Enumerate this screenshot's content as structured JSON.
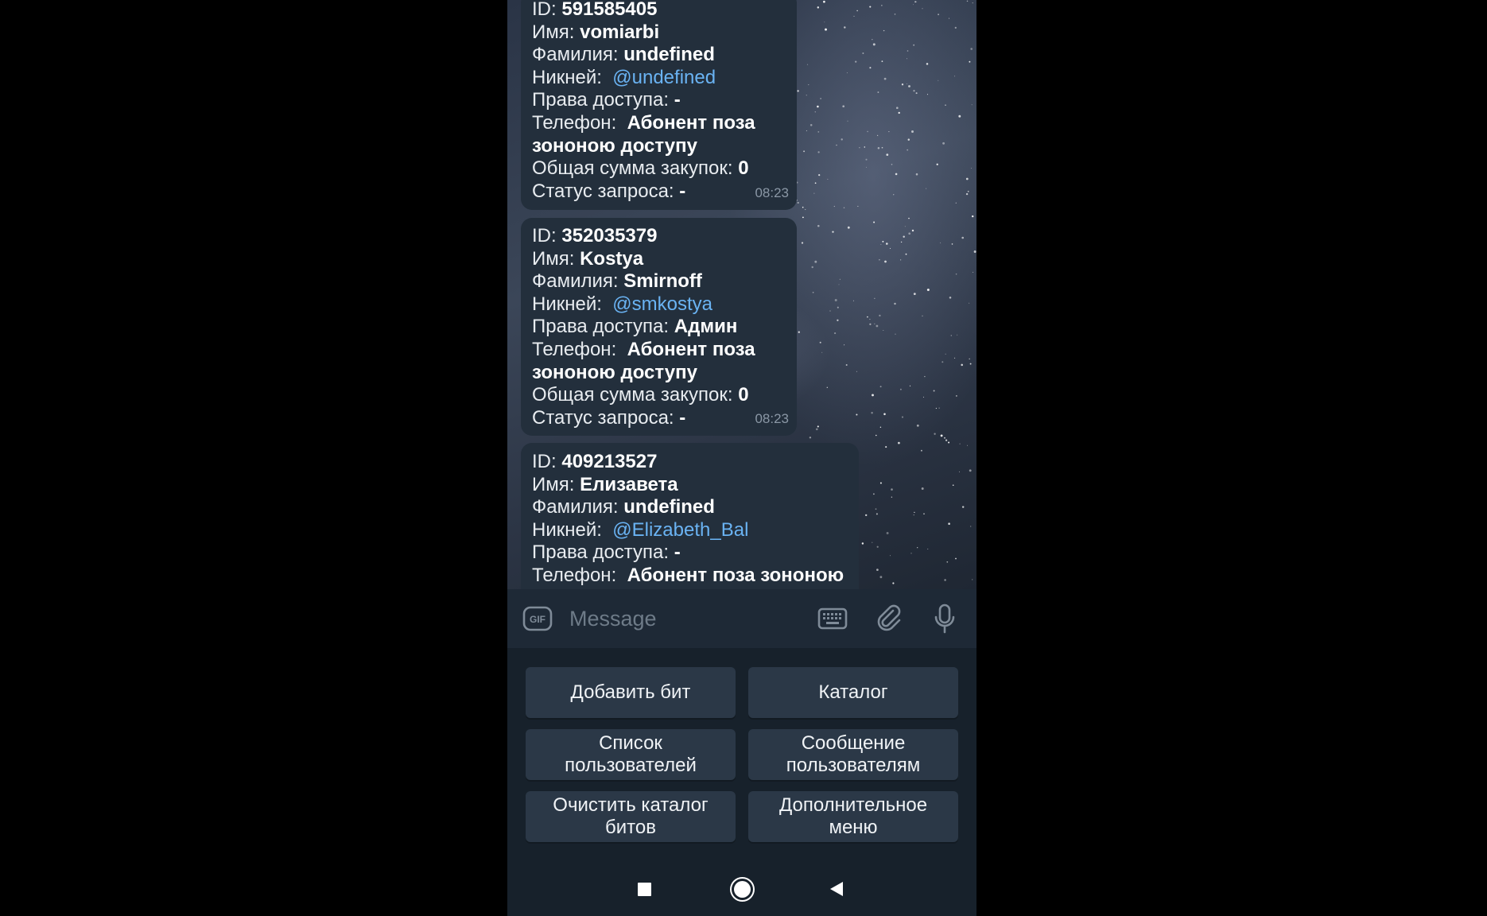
{
  "messages": [
    {
      "id_label": "ID:",
      "id": "591585405",
      "name_label": "Имя:",
      "name": "vomiarbi",
      "surname_label": "Фамилия:",
      "surname": "undefined",
      "nick_label": "Никней:",
      "nick": "@undefined",
      "rights_label": "Права доступа:",
      "rights": "-",
      "phone_label": "Телефон:",
      "phone": "Абонент поза зононою доступу",
      "total_label": "Общая сумма закупок:",
      "total": "0",
      "status_label": "Статус запроса:",
      "status": "-",
      "time": "08:23"
    },
    {
      "id_label": "ID:",
      "id": "352035379",
      "name_label": "Имя:",
      "name": "Kostya",
      "surname_label": "Фамилия:",
      "surname": "Smirnoff",
      "nick_label": "Никней:",
      "nick": "@smkostya",
      "rights_label": "Права доступа:",
      "rights": "Админ",
      "phone_label": "Телефон:",
      "phone": "Абонент поза зононою доступу",
      "total_label": "Общая сумма закупок:",
      "total": "0",
      "status_label": "Статус запроса:",
      "status": "-",
      "time": "08:23"
    },
    {
      "id_label": "ID:",
      "id": "409213527",
      "name_label": "Имя:",
      "name": "Елизавета",
      "surname_label": "Фамилия:",
      "surname": "undefined",
      "nick_label": "Никней:",
      "nick": "@Elizabeth_Bal",
      "rights_label": "Права доступа:",
      "rights": "-",
      "phone_label": "Телефон:",
      "phone": "Абонент поза зононою"
    }
  ],
  "input": {
    "placeholder": "Message",
    "gif_label": "GIF"
  },
  "keyboard": {
    "buttons": [
      "Добавить бит",
      "Каталог",
      "Список пользователей",
      "Сообщение пользователям",
      "Очистить каталог битов",
      "Дополнительное меню"
    ]
  },
  "icons": {
    "gif": "gif-icon",
    "keyboard": "keyboard-icon",
    "attach": "paperclip-icon",
    "mic": "microphone-icon",
    "nav_recent": "square-icon",
    "nav_home": "circle-icon",
    "nav_back": "triangle-back-icon"
  },
  "colors": {
    "link": "#6ab3f3",
    "bubble": "#232f3c",
    "panel": "#17212b",
    "button": "#2b3847"
  }
}
